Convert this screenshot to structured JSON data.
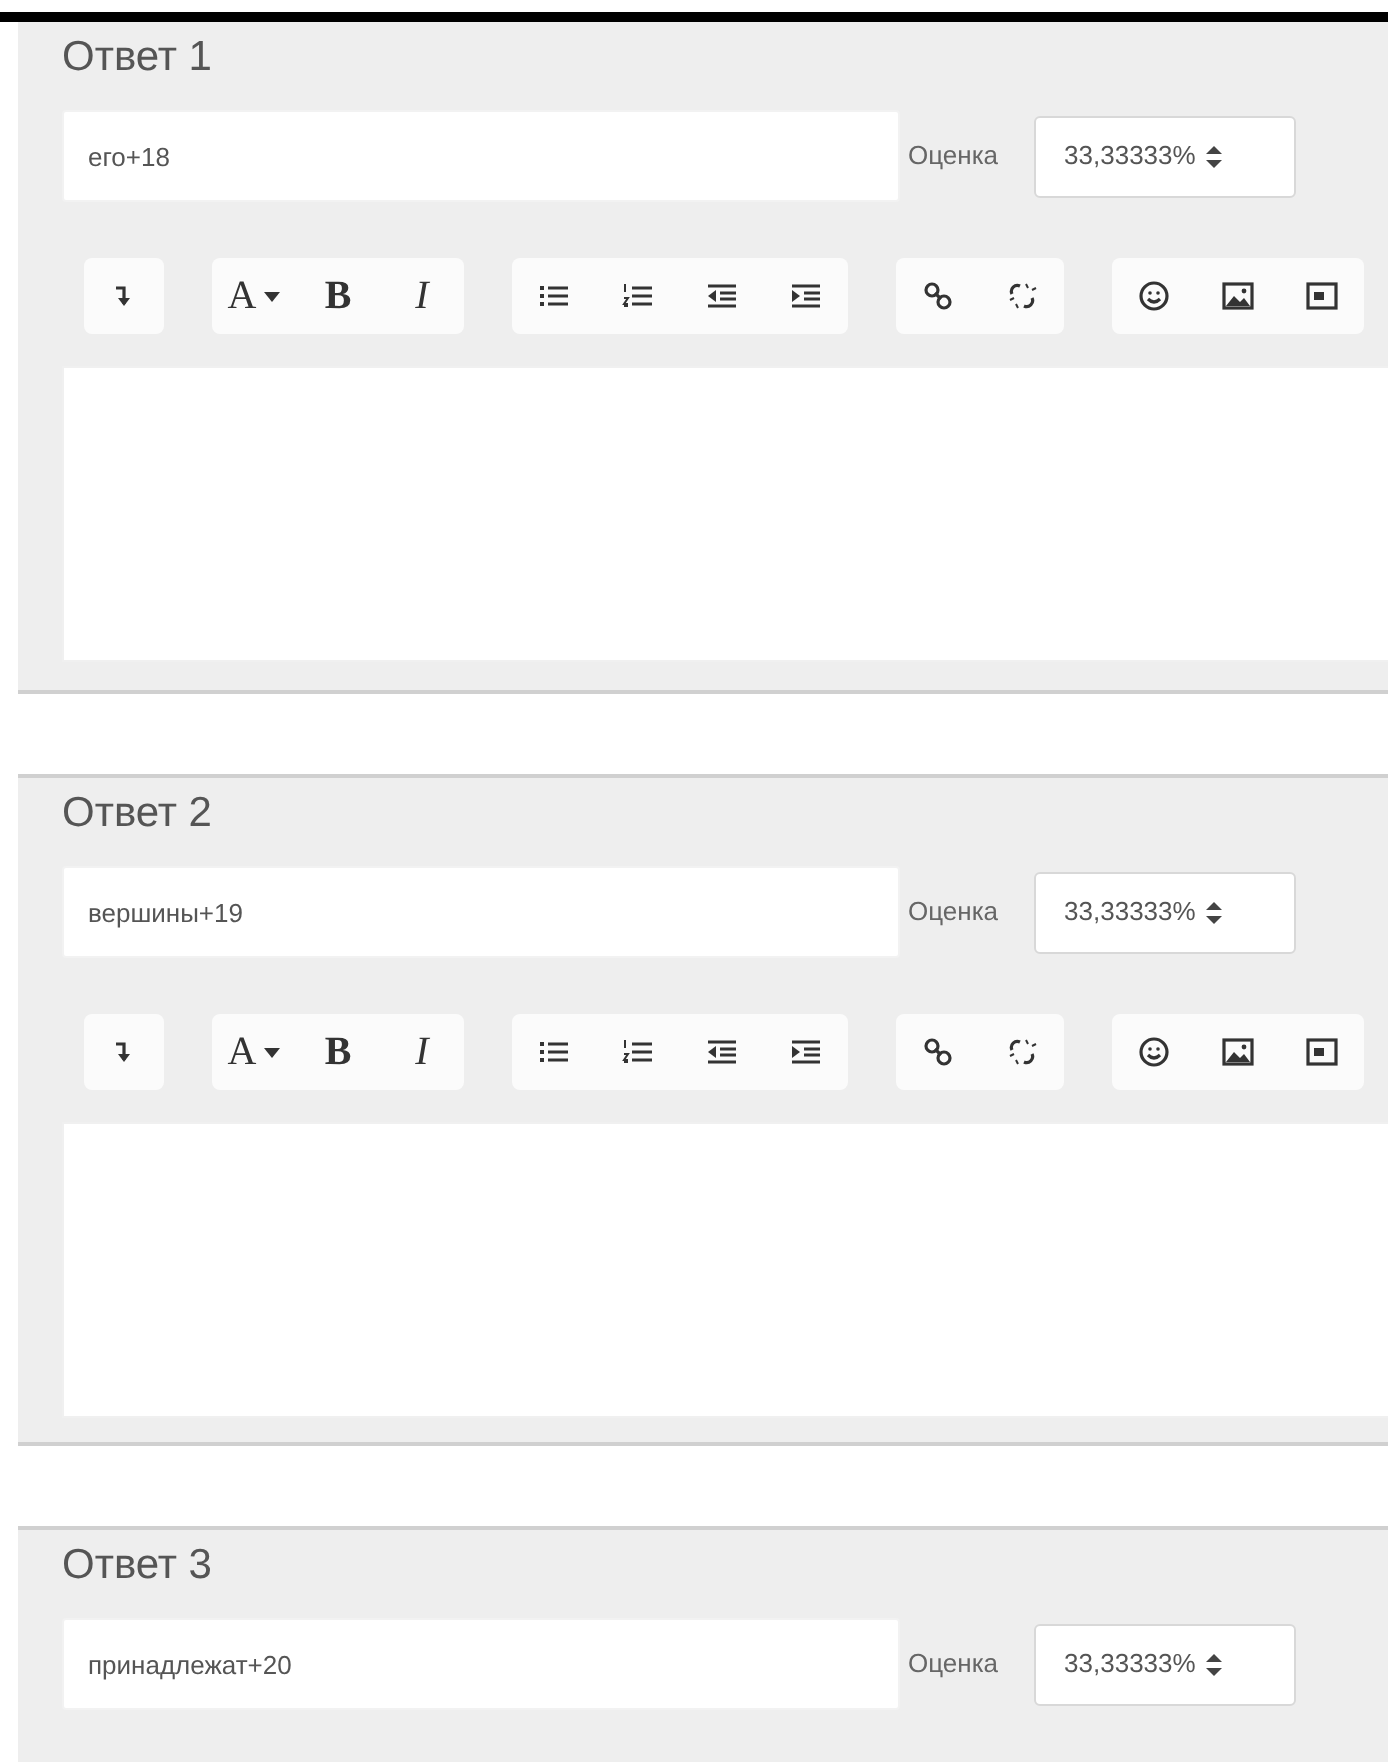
{
  "answers": [
    {
      "title": "Ответ 1",
      "answer": "его+18",
      "grade_label": "Оценка",
      "grade": "33,33333%",
      "toolbar": [
        [
          {
            "kind": "icon"
          }
        ],
        [
          {
            "kind": "menu",
            "label": "A"
          },
          {
            "kind": "bold",
            "label": "B"
          },
          {
            "kind": "italic",
            "label": "I"
          }
        ],
        [
          {
            "kind": "icon"
          },
          {
            "kind": "icon"
          },
          {
            "kind": "icon"
          },
          {
            "kind": "icon"
          }
        ],
        [
          {
            "kind": "icon"
          },
          {
            "kind": "icon"
          }
        ],
        [
          {
            "kind": "icon"
          },
          {
            "kind": "icon"
          },
          {
            "kind": "icon"
          }
        ]
      ]
    },
    {
      "title": "Ответ 2",
      "answer": "вершины+19",
      "grade_label": "Оценка",
      "grade": "33,33333%",
      "toolbar": [
        [
          {
            "kind": "icon"
          }
        ],
        [
          {
            "kind": "menu",
            "label": "A"
          },
          {
            "kind": "bold",
            "label": "B"
          },
          {
            "kind": "italic",
            "label": "I"
          }
        ],
        [
          {
            "kind": "icon"
          },
          {
            "kind": "icon"
          },
          {
            "kind": "icon"
          },
          {
            "kind": "icon"
          }
        ],
        [
          {
            "kind": "icon"
          },
          {
            "kind": "icon"
          }
        ],
        [
          {
            "kind": "icon"
          },
          {
            "kind": "icon"
          },
          {
            "kind": "icon"
          }
        ]
      ]
    },
    {
      "title": "Ответ 3",
      "answer": "принадлежат+20",
      "grade_label": "Оценка",
      "grade": "33,33333%"
    }
  ]
}
